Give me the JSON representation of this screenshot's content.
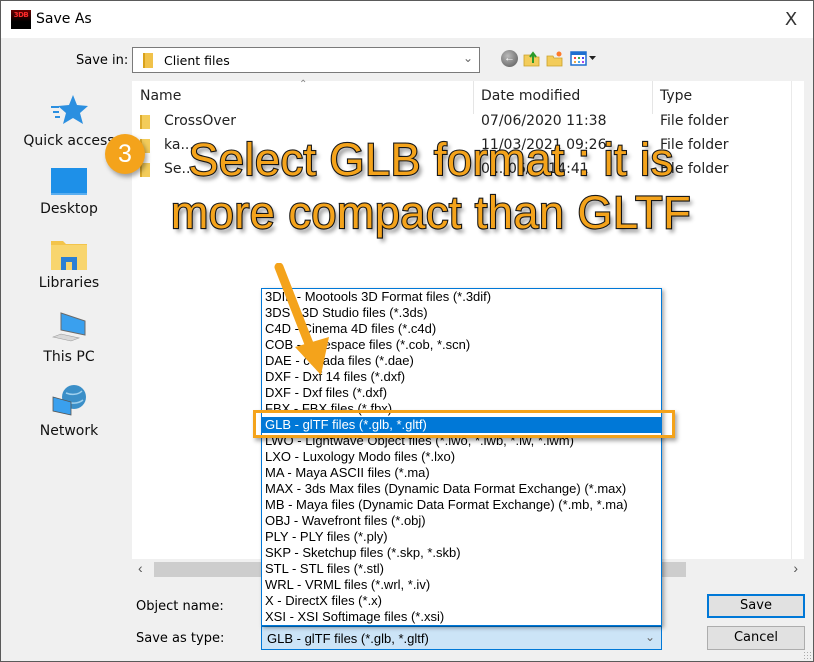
{
  "window": {
    "title": "Save As",
    "app_icon_text": "3DB",
    "close_glyph": "X"
  },
  "toolbar": {
    "save_in_label": "Save in:",
    "save_in_value": "Client files",
    "icons": [
      "back-icon",
      "up-folder-icon",
      "new-folder-icon",
      "view-menu-icon"
    ]
  },
  "sidebar": {
    "items": [
      {
        "label": "Quick access",
        "icon": "star-icon"
      },
      {
        "label": "Desktop",
        "icon": "desktop-icon"
      },
      {
        "label": "Libraries",
        "icon": "libraries-icon"
      },
      {
        "label": "This PC",
        "icon": "computer-icon"
      },
      {
        "label": "Network",
        "icon": "network-icon"
      }
    ]
  },
  "filelist": {
    "columns": [
      "Name",
      "Date modified",
      "Type"
    ],
    "rows": [
      {
        "name": "CrossOver",
        "date": "07/06/2020 11:38",
        "type": "File folder"
      },
      {
        "name": "ka...",
        "date": "11/03/2021 09:26",
        "type": "File folder"
      },
      {
        "name": "Se...",
        "date": "0.../06/... 14:41",
        "type": "File folder"
      }
    ]
  },
  "form": {
    "object_name_label": "Object name:",
    "object_name_value": "",
    "save_as_type_label": "Save as type:",
    "save_as_type_value": "GLB - glTF files (*.glb, *.gltf)",
    "save_button": "Save",
    "cancel_button": "Cancel"
  },
  "dropdown": {
    "selected_index": 8,
    "options": [
      "3DIF - Mootools 3D Format files (*.3dif)",
      "3DS - 3D Studio files (*.3ds)",
      "C4D - Cinema 4D files (*.c4d)",
      "COB - Truespace files (*.cob, *.scn)",
      "DAE - collada files (*.dae)",
      "DXF - Dxf 14 files (*.dxf)",
      "DXF - Dxf files (*.dxf)",
      "FBX - FBX files (*.fbx)",
      "GLB - glTF files (*.glb, *.gltf)",
      "LWO - Lightwave Object files (*.lwo, *.lwb, *.lw, *.lwm)",
      "LXO - Luxology Modo files (*.lxo)",
      "MA - Maya ASCII files (*.ma)",
      "MAX - 3ds Max files (Dynamic Data Format Exchange) (*.max)",
      "MB - Maya files (Dynamic Data Format Exchange) (*.mb, *.ma)",
      "OBJ - Wavefront files (*.obj)",
      "PLY - PLY files (*.ply)",
      "SKP - Sketchup files (*.skp, *.skb)",
      "STL - STL files (*.stl)",
      "WRL - VRML files (*.wrl, *.iv)",
      "X - DirectX files (*.x)",
      "XSI - XSI Softimage files (*.xsi)"
    ]
  },
  "annotation": {
    "step_number": "3",
    "callout_line1": "Select GLB format : it is",
    "callout_line2": "more compact than GLTF",
    "accent_color": "#f4a31b"
  }
}
